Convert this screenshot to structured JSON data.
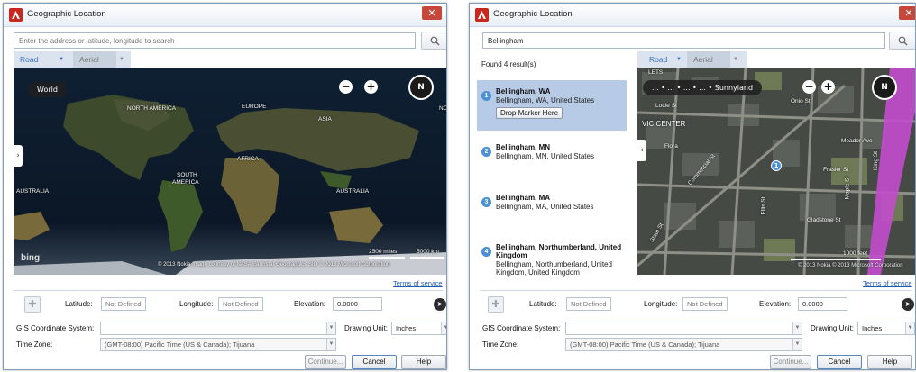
{
  "dialog_left": {
    "title": "Geographic Location",
    "close_glyph": "✕",
    "search": {
      "value": "",
      "placeholder": "Enter the address or latitude, longitude to search"
    },
    "search_icon": "search-icon",
    "tabs": {
      "road": "Road",
      "aerial": "Aerial",
      "arrow": "▼"
    },
    "map": {
      "world_button": "World",
      "zoom_out": "−",
      "zoom_in": "+",
      "compass": "N",
      "side_arrow": "›",
      "labels": {
        "north_america": "NORTH AMERICA",
        "europe": "EUROPE",
        "asia": "ASIA",
        "africa": "AFRICA",
        "south_america_1": "SOUTH",
        "south_america_2": "AMERICA",
        "australia_left": "AUSTRALIA",
        "australia_right": "AUSTRALIA",
        "no": "NO"
      },
      "scale_miles": "2500 miles",
      "scale_km": "5000 km",
      "copyright": "© 2013 Nokia    Image courtesy of NASA    Earthstar Geographics SIO    © 2013 Microsoft Corporation",
      "bing": "bing"
    },
    "terms": "Terms of service",
    "latitude": {
      "label": "Latitude:",
      "placeholder": "Not Defined"
    },
    "longitude": {
      "label": "Longitude:",
      "placeholder": "Not Defined"
    },
    "elevation": {
      "label": "Elevation:",
      "value": "0.0000"
    },
    "gis_label": "GIS Coordinate System:",
    "gis_value": "",
    "drawing_unit": {
      "label": "Drawing Unit:",
      "value": "Inches"
    },
    "time_zone": {
      "label": "Time Zone:",
      "value": "(GMT-08:00) Pacific Time (US & Canada); Tijuana"
    },
    "buttons": {
      "continue": "Continue...",
      "cancel": "Cancel",
      "help": "Help"
    }
  },
  "dialog_right": {
    "title": "Geographic Location",
    "close_glyph": "✕",
    "search": {
      "value": "Bellingham",
      "placeholder": ""
    },
    "found": "Found 4 result(s)",
    "results": [
      {
        "num": "1",
        "name": "Bellingham, WA",
        "detail": "Bellingham, WA, United States"
      },
      {
        "num": "2",
        "name": "Bellingham, MN",
        "detail": "Bellingham, MN, United States"
      },
      {
        "num": "3",
        "name": "Bellingham, MA",
        "detail": "Bellingham, MA, United States"
      },
      {
        "num": "4",
        "name": "Bellingham, Northumberland, United Kingdom",
        "detail": "Bellingham, Northumberland, United Kingdom, United Kingdom"
      }
    ],
    "drop_marker": "Drop Marker Here",
    "tabs": {
      "road": "Road",
      "aerial": "Aerial",
      "arrow": "▼"
    },
    "map": {
      "breadcrumb": "... • ... • ... • ... • Sunnyland",
      "zoom_out": "−",
      "zoom_in": "+",
      "compass": "N",
      "side_arrow": "‹",
      "pin": "1",
      "labels": {
        "onio": "Onio St",
        "lottie": "Lottie St",
        "civic": "VIC CENTER",
        "flora": "Flora",
        "meador": "Meador Ave",
        "frasier": "Frasier St",
        "king": "King St",
        "gladstone": "Gladstone St",
        "lets": "LETS",
        "commercial": "Commercial St",
        "ellis": "Ellis St",
        "state": "State St",
        "maple": "Maple St"
      },
      "scale_feet": "1000 feet",
      "copyright": "© 2013 Nokia    © 2013 Microsoft Corporation"
    },
    "terms": "Terms of service",
    "latitude": {
      "label": "Latitude:",
      "placeholder": "Not Defined"
    },
    "longitude": {
      "label": "Longitude:",
      "placeholder": "Not Defined"
    },
    "elevation": {
      "label": "Elevation:",
      "value": "0.0000"
    },
    "gis_label": "GIS Coordinate System:",
    "gis_value": "",
    "drawing_unit": {
      "label": "Drawing Unit:",
      "value": "Inches"
    },
    "time_zone": {
      "label": "Time Zone:",
      "value": "(GMT-08:00) Pacific Time (US & Canada); Tijuana"
    },
    "buttons": {
      "continue": "Continue...",
      "cancel": "Cancel",
      "help": "Help"
    }
  },
  "colors": {
    "accent": "#3a72c4",
    "close": "#c7483a",
    "selection": "#b7cbe6",
    "ocean": "#0d1b2a",
    "route": "#c24ccc"
  }
}
